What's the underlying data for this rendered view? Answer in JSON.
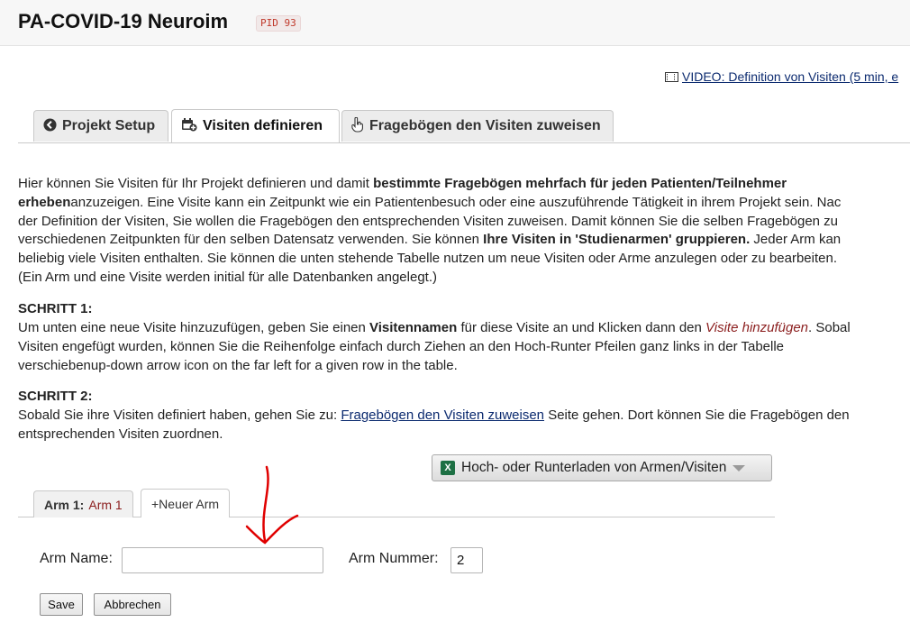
{
  "project": {
    "title": "PA-COVID-19 Neuroim",
    "pid_badge": "PID 93"
  },
  "video_link": {
    "text": "VIDEO: Definition von Visiten (5 min, e"
  },
  "tabs": [
    {
      "label": "Projekt Setup",
      "icon": "circle-arrow-left-icon"
    },
    {
      "label": "Visiten definieren",
      "icon": "calendar-plus-icon"
    },
    {
      "label": "Fragebögen den Visiten zuweisen",
      "icon": "pointer-hand-icon"
    }
  ],
  "intro": {
    "l1_a": "Hier können Sie Visiten für Ihr Projekt definieren und damit ",
    "l1_b": "bestimmte Fragebögen mehrfach für jeden Patienten/Teilnehmer",
    "l2_a": "erheben",
    "l2_b": "anzuzeigen. Eine Visite kann ein Zeitpunkt wie ein Patientenbesuch oder eine auszuführende Tätigkeit in ihrem Projekt sein. Nac",
    "l3": "der Definition der Visiten, Sie wollen die Fragebögen den entsprechenden Visiten zuweisen. Damit können Sie die selben Fragebögen zu",
    "l4_a": "verschiedenen Zeitpunkten für den selben Datensatz verwenden. Sie können ",
    "l4_b": "Ihre Visiten in 'Studienarmen' gruppieren.",
    "l4_c": " Jeder Arm kan",
    "l5": "beliebig viele Visiten enthalten. Sie können die unten stehende Tabelle nutzen um neue Visiten oder Arme anzulegen oder zu bearbeiten.",
    "l6": "(Ein Arm und eine Visite werden initial für alle Datenbanken angelegt.)"
  },
  "step1": {
    "heading": "SCHRITT 1:",
    "l1_a": "Um unten eine neue Visite hinzuzufügen, geben Sie einen ",
    "l1_b": "Visitennamen",
    "l1_c": " für diese Visite an und Klicken dann den ",
    "l1_d": "Visite hinzufügen",
    "l1_e": ". Sobal",
    "l2": "Visiten engefügt wurden, können Sie die Reihenfolge einfach durch Ziehen an den Hoch-Runter Pfeilen ganz links in der Tabelle",
    "l3": "verschiebenup-down arrow icon on the far left for a given row in the table."
  },
  "step2": {
    "heading": "SCHRITT 2:",
    "l1_a": "Sobald Sie ihre Visiten definiert haben, gehen Sie zu: ",
    "l1_link": "Fragebögen den Visiten zuweisen",
    "l1_b": " Seite gehen. Dort können Sie die Fragebögen den",
    "l2": "entsprechenden Visiten zuordnen."
  },
  "download_button": {
    "label": "Hoch- oder Runterladen von Armen/Visiten",
    "icon": "excel-icon"
  },
  "arm_tabs": {
    "arm1_label": "Arm 1:",
    "arm1_name": "Arm 1",
    "new_arm_label": "+Neuer Arm"
  },
  "form": {
    "arm_name_label": "Arm Name:",
    "arm_name_value": "",
    "arm_number_label": "Arm Nummer:",
    "arm_number_value": "2",
    "save_label": "Save",
    "cancel_label": "Abbrechen"
  },
  "colors": {
    "accent_red": "#8b1e1e",
    "link_blue": "#0b2a6f",
    "annotation_red": "#e00000"
  }
}
